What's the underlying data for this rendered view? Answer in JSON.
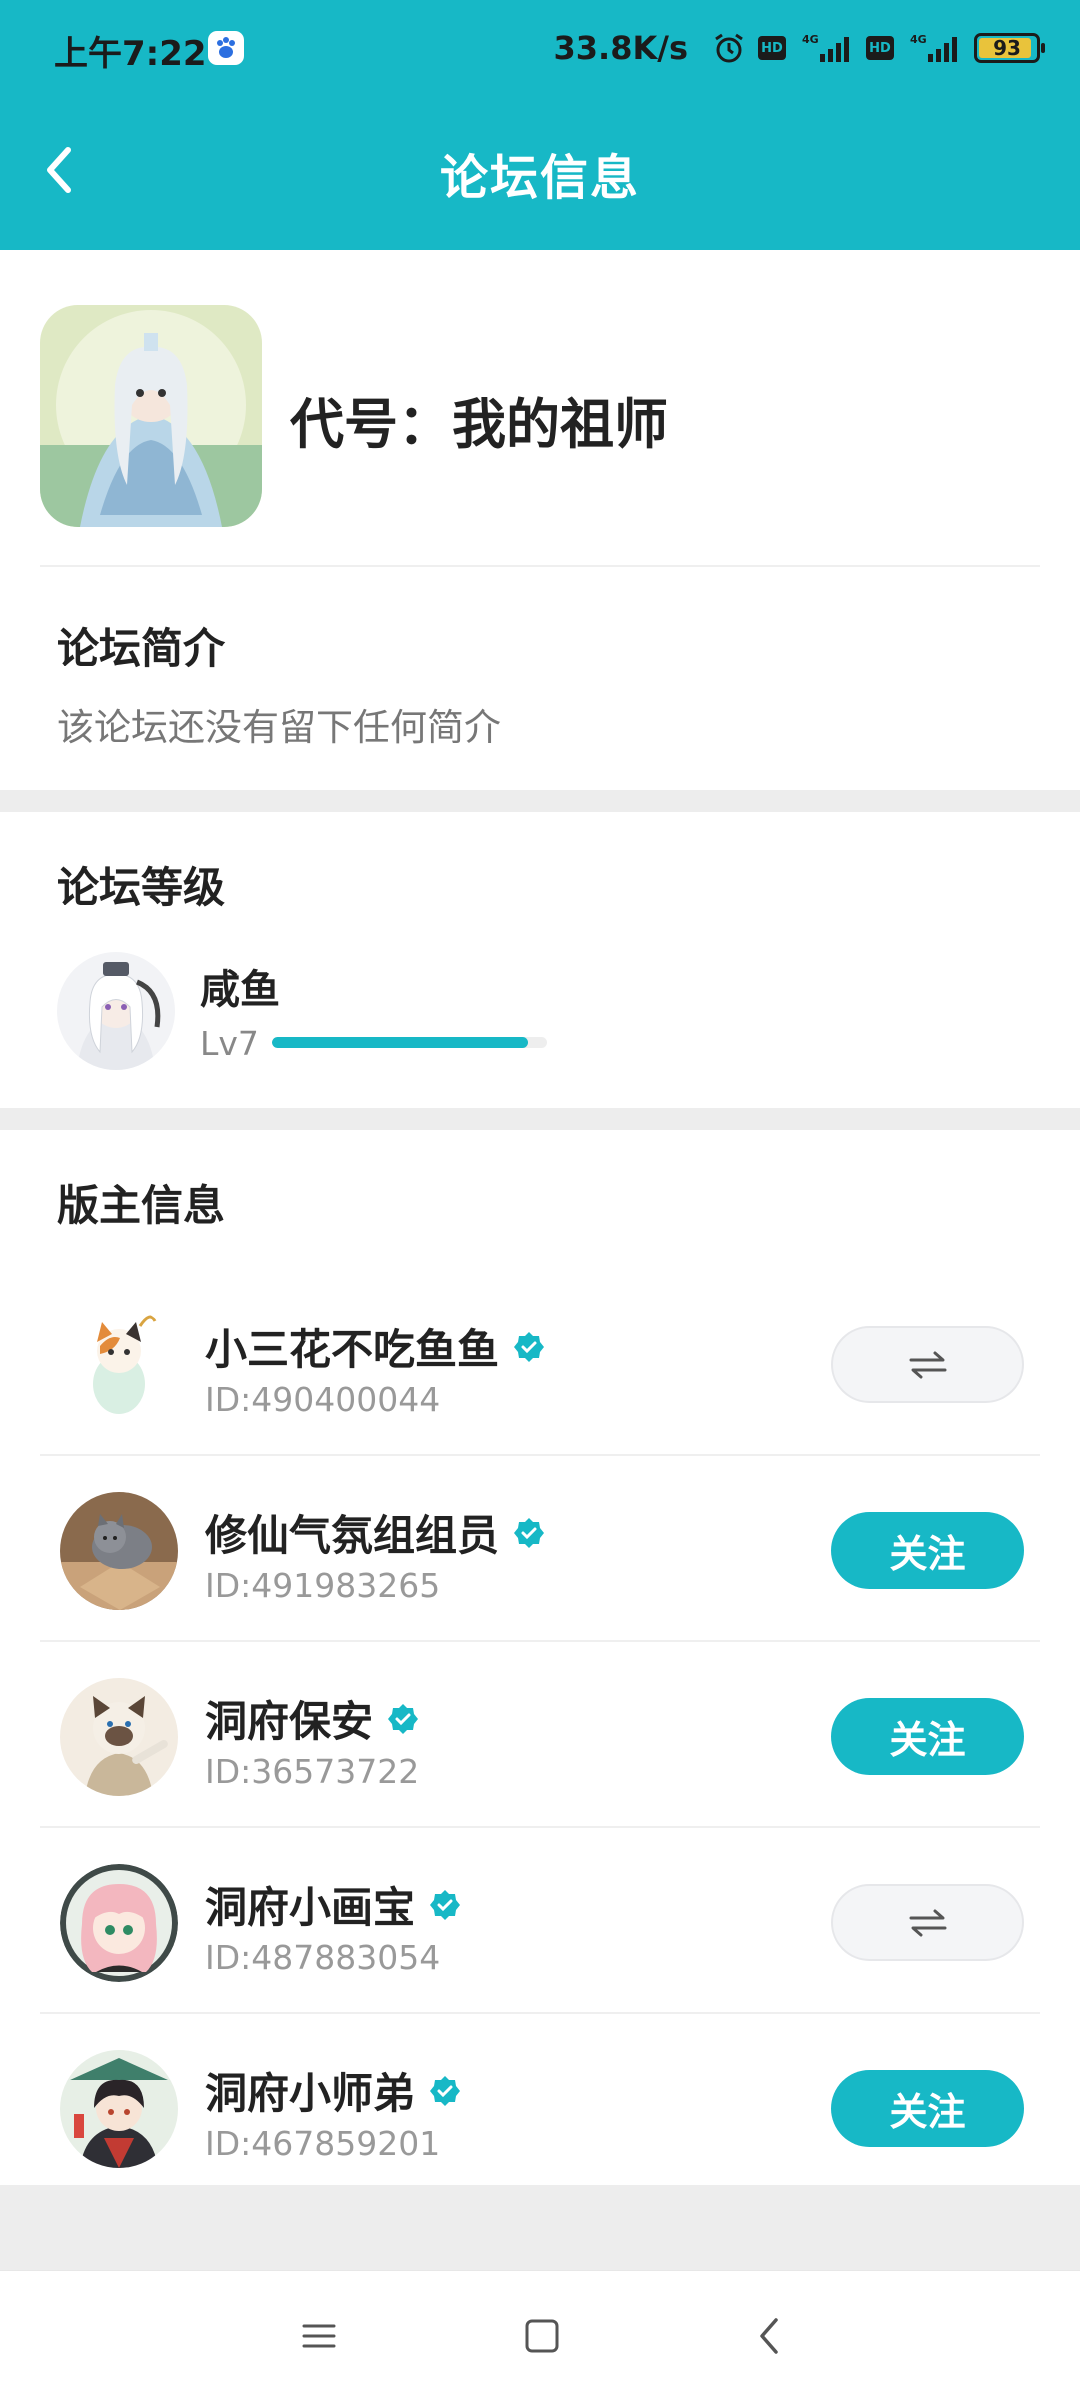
{
  "status_bar": {
    "time": "上午7:22",
    "speed": "33.8K/s",
    "battery": "93",
    "icons": [
      "baidu-paw-icon",
      "alarm-icon",
      "hd-icon",
      "signal-4g-icon",
      "hd-icon",
      "signal-4g-icon",
      "battery-icon"
    ]
  },
  "header": {
    "title": "论坛信息",
    "back_icon": "chevron-left-icon"
  },
  "forum": {
    "name": "代号：我的祖师"
  },
  "intro": {
    "title": "论坛简介",
    "text": "该论坛还没有留下任何简介"
  },
  "level": {
    "title": "论坛等级",
    "name": "咸鱼",
    "lv": "Lv7",
    "progress": 0.93
  },
  "moderators": {
    "title": "版主信息",
    "items": [
      {
        "name": "小三花不吃鱼鱼",
        "id": "ID:490400044",
        "action": "mutual",
        "action_icon": "mutual-follow-icon"
      },
      {
        "name": "修仙气氛组组员",
        "id": "ID:491983265",
        "action": "follow",
        "action_label": "关注"
      },
      {
        "name": "洞府保安",
        "id": "ID:36573722",
        "action": "follow",
        "action_label": "关注"
      },
      {
        "name": "洞府小画宝",
        "id": "ID:487883054",
        "action": "mutual",
        "action_icon": "mutual-follow-icon"
      },
      {
        "name": "洞府小师弟",
        "id": "ID:467859201",
        "action": "follow",
        "action_label": "关注"
      }
    ]
  },
  "nav": {
    "icons": [
      "menu-icon",
      "home-square-icon",
      "back-triangle-icon"
    ]
  },
  "colors": {
    "accent": "#17b8c6",
    "background": "#ededed",
    "muted_text": "#999999"
  }
}
